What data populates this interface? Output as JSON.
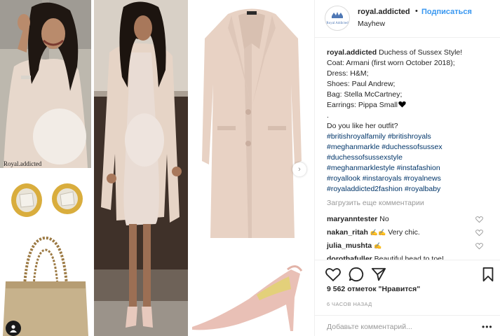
{
  "post": {
    "username": "royal.addicted",
    "dot": "•",
    "follow_label": "Подписаться",
    "location": "Mayhew",
    "avatar_text": "Royal Addicted"
  },
  "media": {
    "watermark": "Royal.addicted",
    "next_arrow": "›"
  },
  "caption": {
    "username": "royal.addicted",
    "lines": [
      "Duchess of Sussex Style!",
      "Coat: Armani (first worn October 2018);",
      "Dress: H&M;",
      "Shoes: Paul Andrew;",
      "Bag: Stella McCartney;",
      "Earrings: Pippa Small",
      ".",
      "Do you like her outfit?"
    ],
    "hashtag_lines": [
      "#britishroyalfamily #britishroyals",
      "#meghanmarkle #duchessofsussex",
      "#duchessofsussexstyle",
      "#meghanmarklestyle #instafashion",
      "#royallook #instaroyals #royalnews",
      "#royaladdicted2fashion #royalbaby"
    ]
  },
  "load_more": "Загрузить еще комментарии",
  "comments": [
    {
      "user": "maryanntester",
      "text": "No"
    },
    {
      "user": "nakan_ritah",
      "text": "Very chic."
    },
    {
      "user": "julia_mushta",
      "text": ""
    },
    {
      "user": "dorothafuller",
      "text": "Beautiful head to toe!"
    }
  ],
  "likes": "9 562 отметок \"Нравится\"",
  "time_ago": "6 ЧАСОВ НАЗАД",
  "add_comment_placeholder": "Добавьте комментарий...",
  "more_label": "•••",
  "icons": [
    "heart-icon",
    "comment-icon",
    "share-icon",
    "bookmark-icon",
    "black-heart-icon",
    "clap-icon",
    "person-tag-icon"
  ],
  "colors": {
    "link": "#3897f0",
    "hashtag": "#003569",
    "muted": "#999999",
    "text": "#262626"
  }
}
